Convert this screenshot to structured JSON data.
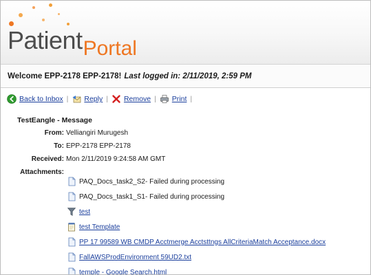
{
  "header": {
    "logo_part1": "Patient",
    "logo_part2": "Portal"
  },
  "welcome": {
    "greeting": "Welcome EPP-2178 EPP-2178!",
    "last_logged": "Last logged in: 2/11/2019, 2:59 PM"
  },
  "toolbar": {
    "back": "Back to Inbox",
    "reply": "Reply",
    "remove": "Remove",
    "print": "Print",
    "separator": "|"
  },
  "message": {
    "subject": "TestEangle - Message",
    "from_label": "From:",
    "from": "Velliangiri Murugesh",
    "to_label": "To:",
    "to": "EPP-2178 EPP-2178",
    "received_label": "Received:",
    "received": "Mon 2/11/2019 9:24:58 AM GMT",
    "attachments_label": "Attachments:",
    "attachments": [
      {
        "name": "PAQ_Docs_task2_S2- Failed during processing",
        "icon": "document-icon",
        "link": false
      },
      {
        "name": "PAQ_Docs_task1_S1- Failed during processing",
        "icon": "document-icon",
        "link": false
      },
      {
        "name": "test",
        "icon": "filter-icon",
        "link": true
      },
      {
        "name": "test Template",
        "icon": "notepad-icon",
        "link": true
      },
      {
        "name": "PP 17 99589 WB CMDP Acctmerge Acctsttngs AllCriteriaMatch Acceptance.docx",
        "icon": "document-icon",
        "link": true
      },
      {
        "name": "FallAWSProdEnvironment 59UD2.txt",
        "icon": "document-icon",
        "link": true
      },
      {
        "name": "temple - Google Search.html",
        "icon": "document-icon",
        "link": true
      }
    ]
  },
  "colors": {
    "brand_orange": "#ee7723",
    "logo_gray": "#4d4d4d",
    "link_blue": "#1a3e9c",
    "back_green": "#2f9a2f",
    "remove_red": "#d42020"
  }
}
